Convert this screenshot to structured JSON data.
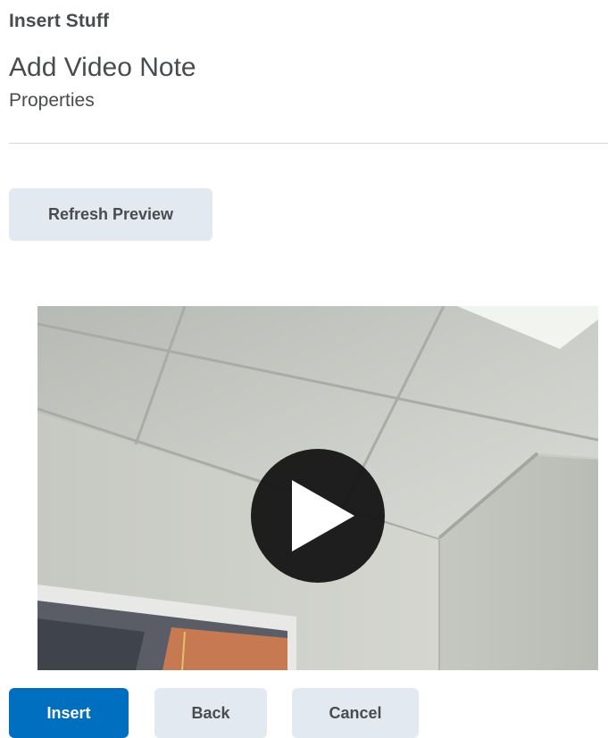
{
  "header": {
    "dialog_title": "Insert Stuff",
    "page_title": "Add Video Note",
    "page_subtitle": "Properties"
  },
  "actions": {
    "refresh_label": "Refresh Preview"
  },
  "video": {
    "play_icon": "play-icon"
  },
  "footer": {
    "insert_label": "Insert",
    "back_label": "Back",
    "cancel_label": "Cancel"
  },
  "colors": {
    "primary": "#006fbf",
    "secondary_button": "#e3e9f1",
    "text": "#494c4e",
    "divider": "#d3d9e3"
  }
}
